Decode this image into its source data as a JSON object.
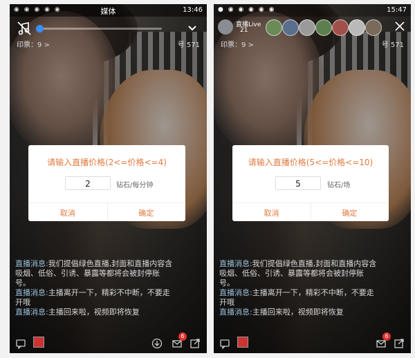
{
  "left_phone": {
    "status_title": "媒体",
    "time": "13:46",
    "impressions": "印票：9 >",
    "room_no": "号 571",
    "dialog": {
      "title": "请输入直播价格(2<=价格<=4)",
      "input_value": "2",
      "unit": "钻石/每分钟",
      "cancel": "取消",
      "confirm": "确定"
    },
    "chat": [
      {
        "label": "直播消息:",
        "text": "我们提倡绿色直播,封面和直播内容含吸烟、低俗、引诱、暴露等都将会被封停账号。"
      },
      {
        "label": "直播消息:",
        "text": "主播离开一下，精彩不中断，不要走开哦"
      },
      {
        "label": "直播消息:",
        "text": "主播回来啦，视频即将恢复"
      }
    ],
    "mail_badge": "6"
  },
  "right_phone": {
    "time": "15:47",
    "host_name": "直播Live",
    "viewer_count": "21",
    "impressions": "印票：9 >",
    "room_no": "号 571",
    "dialog": {
      "title": "请输入直播价格(5<=价格<=10)",
      "input_value": "5",
      "unit": "钻石/场",
      "cancel": "取消",
      "confirm": "确定"
    },
    "chat": [
      {
        "label": "直播消息:",
        "text": "我们提倡绿色直播,封面和直播内容含吸烟、低俗、引诱、暴露等都将会被封停账号。"
      },
      {
        "label": "直播消息:",
        "text": "主播离开一下，精彩不中断，不要走开哦"
      },
      {
        "label": "直播消息:",
        "text": "主播回来啦，视频即将恢复"
      }
    ],
    "mail_badge": "6"
  },
  "colors": {
    "accent": "#e27a3f",
    "slider": "#3a8ef6",
    "badge": "#e03030"
  }
}
